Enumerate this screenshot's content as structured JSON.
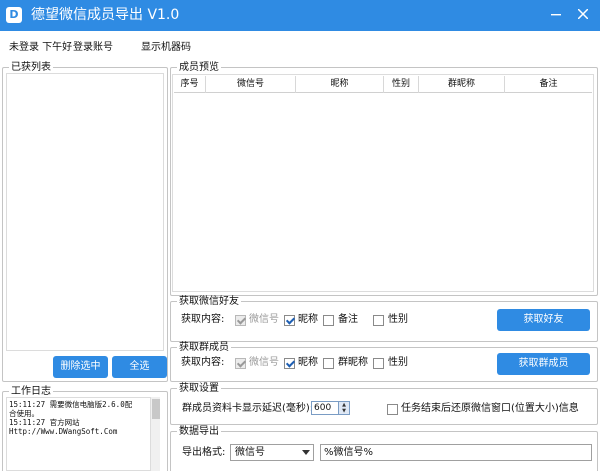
{
  "window": {
    "title": "德望微信成员导出 V1.0",
    "logo_glyph": "D",
    "accent_color": "#2f8be3"
  },
  "toolbar": {
    "login_status": "未登录 下午好",
    "login_account": "登录账号",
    "show_machine_code": "显示机器码"
  },
  "left_panel": {
    "title": "已获列表",
    "delete_button": "删除选中",
    "select_all_button": "全选"
  },
  "log_panel": {
    "title": "工作日志",
    "lines": [
      "15:11:27  需要微信电脑版2.6.0配",
      "合使用。",
      "15:11:27  官方网站",
      "Http://Www.DWangSoft.Com"
    ]
  },
  "members_panel": {
    "title": "成员预览",
    "columns": [
      "序号",
      "微信号",
      "昵称",
      "性别",
      "群昵称",
      "备注"
    ]
  },
  "friends_panel": {
    "title": "获取微信好友",
    "content_label": "获取内容:",
    "options": [
      {
        "label": "微信号",
        "checked": true,
        "disabled": true
      },
      {
        "label": "昵称",
        "checked": true,
        "disabled": false
      },
      {
        "label": "备注",
        "checked": false,
        "disabled": false
      },
      {
        "label": "性别",
        "checked": false,
        "disabled": false
      }
    ],
    "button": "获取好友"
  },
  "group_panel": {
    "title": "获取群成员",
    "content_label": "获取内容:",
    "options": [
      {
        "label": "微信号",
        "checked": true,
        "disabled": true
      },
      {
        "label": "昵称",
        "checked": true,
        "disabled": false
      },
      {
        "label": "群昵称",
        "checked": false,
        "disabled": false
      },
      {
        "label": "性别",
        "checked": false,
        "disabled": false
      }
    ],
    "button": "获取群成员"
  },
  "settings_panel": {
    "title": "获取设置",
    "delay_label": "群成员资料卡显示延迟(毫秒):",
    "delay_value": "600",
    "restore_label": "任务结束后还原微信窗口(位置大小)信息",
    "restore_checked": false
  },
  "export_panel": {
    "title": "数据导出",
    "format_label": "导出格式:",
    "format_selected": "微信号",
    "format_template": "%微信号%"
  }
}
